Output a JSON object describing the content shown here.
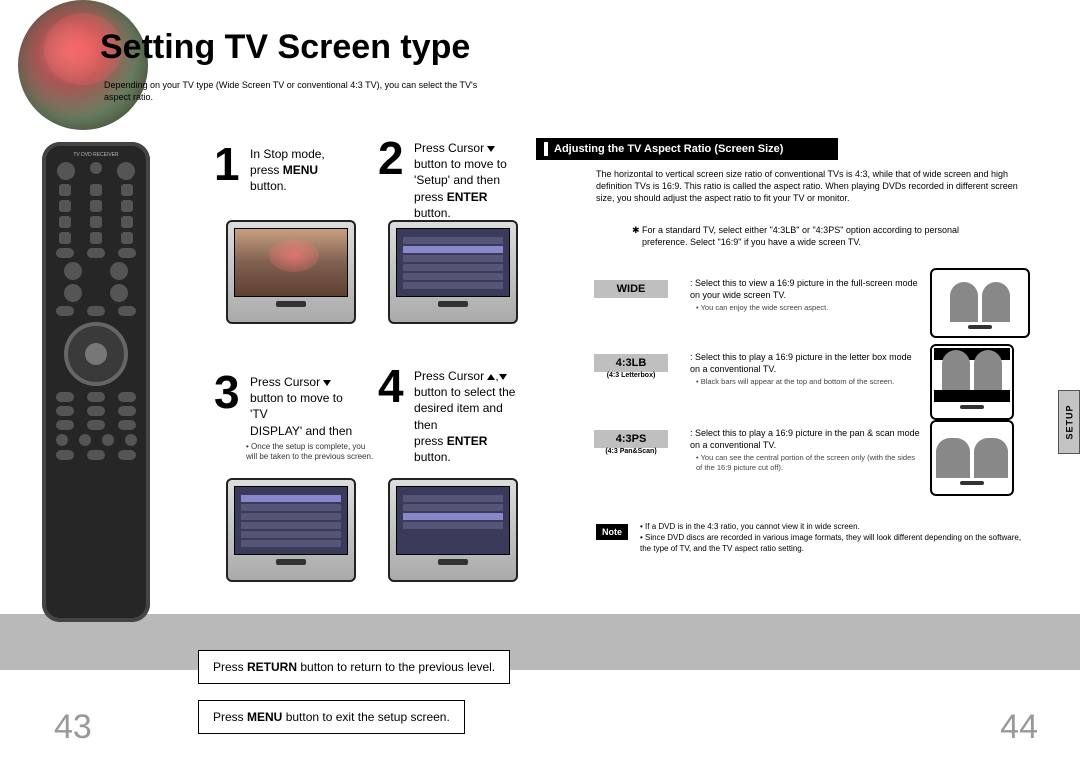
{
  "title": "Setting TV Screen type",
  "subtitle": "Depending on your TV type (Wide Screen TV or conventional 4:3 TV), you can select the TV's aspect ratio.",
  "steps": {
    "s1": {
      "pre": "In Stop mode,",
      "mid_a": "press ",
      "mid_b": "MENU",
      "post": "button."
    },
    "s2": {
      "l1a": "Press Cursor ",
      "l2": "button to move to",
      "l3": "'Setup' and then",
      "l4a": "press ",
      "l4b": "ENTER",
      "l4c": " button."
    },
    "s3": {
      "l1a": "Press Cursor ",
      "l2": "button to move to 'TV",
      "l3": "DISPLAY' and then"
    },
    "s4": {
      "l1a": "Press Cursor ",
      "l1b": ",",
      "l2": "button to select the",
      "l3": "desired item and then",
      "l4a": "press ",
      "l4b": "ENTER",
      "l4c": " button."
    }
  },
  "step_bullet": "Once the setup is complete, you will be taken to the previous screen.",
  "section_title": "Adjusting the TV Aspect Ratio (Screen Size)",
  "section_body": "The horizontal to vertical screen size ratio of conventional TVs is 4:3, while that of wide screen and high definition TVs is 16:9. This ratio is called the aspect ratio. When playing DVDs recorded in different screen size, you should adjust the aspect ratio to fit your TV or monitor.",
  "star_note": "For a standard TV, select either \"4:3LB\" or \"4:3PS\" option according to personal preference. Select \"16:9\" if you have a wide screen TV.",
  "modes": {
    "wide": {
      "label": "WIDE",
      "desc": ": Select this to view a 16:9 picture in the full-screen mode on your wide screen TV.",
      "bullet": "You can enjoy the wide screen aspect."
    },
    "lb": {
      "label": "4:3LB",
      "sub": "(4:3 Letterbox)",
      "desc": ": Select this to play a 16:9 picture in the letter box mode on a conventional TV.",
      "bullet": "Black bars will appear at the top and bottom of the screen."
    },
    "ps": {
      "label": "4:3PS",
      "sub": "(4:3 Pan&Scan)",
      "desc": ": Select this to play a 16:9 picture in the pan & scan mode on a conventional TV.",
      "bullet": "You can see the central portion of the screen only (with the sides of the 16:9 picture cut off)."
    }
  },
  "note": {
    "label": "Note",
    "l1": "If a DVD is in the 4:3 ratio, you cannot view it in wide screen.",
    "l2": "Since DVD discs are recorded in various image formats, they will look different depending on the software, the type of TV, and the TV aspect ratio setting."
  },
  "return_box": {
    "a": "Press ",
    "b": "RETURN",
    "c": " button to return to the previous level."
  },
  "menu_box": {
    "a": "Press ",
    "b": "MENU",
    "c": " button to exit the setup screen."
  },
  "pages": {
    "left": "43",
    "right": "44"
  },
  "side_tab": "SETUP",
  "remote_header": "TV    DVD RECEIVER"
}
